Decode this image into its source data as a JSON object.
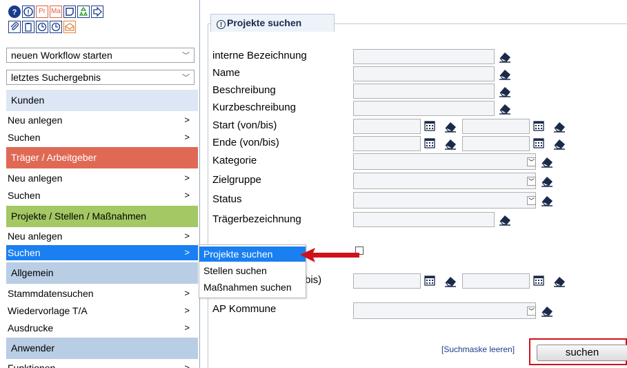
{
  "toolbar": {
    "row1": [
      {
        "icon": "help-icon"
      },
      {
        "icon": "info-icon"
      },
      {
        "label": "Pr",
        "icon": "pr-icon"
      },
      {
        "label": "Ma",
        "icon": "ma-icon"
      },
      {
        "icon": "note-icon"
      },
      {
        "icon": "recycle-icon"
      },
      {
        "icon": "exit-icon"
      }
    ],
    "row2": [
      {
        "icon": "paperclip-icon"
      },
      {
        "icon": "clipboard-icon"
      },
      {
        "icon": "clock-icon"
      },
      {
        "icon": "clock-icon"
      },
      {
        "icon": "envelope-icon"
      }
    ]
  },
  "sidebar": {
    "workflow_select": "neuen Workflow starten",
    "result_select": "letztes Suchergebnis",
    "sections": {
      "kunden": "Kunden",
      "traeger": "Träger / Arbeitgeber",
      "projekte": "Projekte / Stellen / Maßnahmen",
      "allgemein": "Allgemein",
      "anwender": "Anwender"
    },
    "items": {
      "kunden_neu": "Neu anlegen",
      "kunden_suchen": "Suchen",
      "traeger_neu": "Neu anlegen",
      "traeger_suchen": "Suchen",
      "projekte_neu": "Neu anlegen",
      "projekte_suchen": "Suchen",
      "stammdaten": "Stammdatensuchen",
      "wiedervorlage": "Wiedervorlage T/A",
      "ausdrucke": "Ausdrucke",
      "funktionen": "Funktionen"
    },
    "arrow": ">"
  },
  "popup": {
    "items": [
      "Projekte suchen",
      "Stellen suchen",
      "Maßnahmen suchen"
    ]
  },
  "form": {
    "legend": "Projekte suchen",
    "labels": {
      "interne": "interne Bezeichnung",
      "name": "Name",
      "beschreibung": "Beschreibung",
      "kurz": "Kurzbeschreibung",
      "start": "Start (von/bis)",
      "ende": "Ende (von/bis)",
      "kategorie": "Kategorie",
      "zielgruppe": "Zielgruppe",
      "status": "Status",
      "traegerbez": "Trägerbezeichnung",
      "partial": "bis)",
      "ap": "AP Kommune"
    },
    "reset_link": "[Suchmaske leeren]",
    "search_button": "suchen"
  },
  "colors": {
    "accent": "#1a7ff0",
    "red_section": "#e06955",
    "green_section": "#a4c864",
    "highlight_border": "#d0101a"
  }
}
